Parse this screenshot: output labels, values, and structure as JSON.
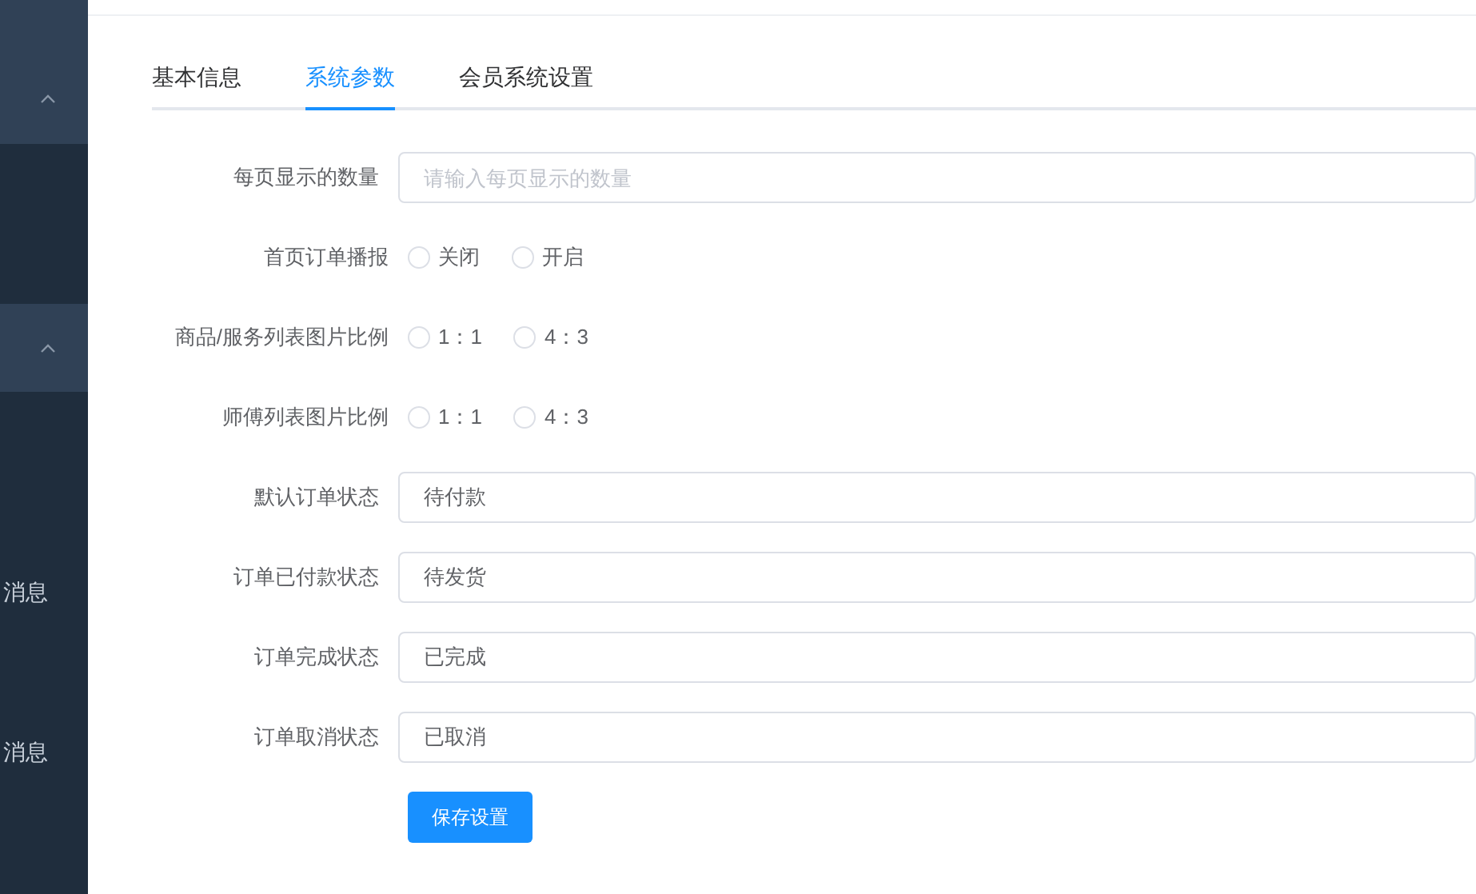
{
  "sidebar": {
    "groups": [
      {
        "expanded": true
      },
      {
        "expanded": true,
        "items": [
          {
            "label": "消息"
          },
          {
            "label": "消息"
          }
        ]
      }
    ]
  },
  "tabs": [
    {
      "label": "基本信息",
      "selected": false
    },
    {
      "label": "系统参数",
      "selected": true
    },
    {
      "label": "会员系统设置",
      "selected": false
    }
  ],
  "form": [
    {
      "kind": "input",
      "label": "每页显示的数量",
      "placeholder": "请输入每页显示的数量"
    },
    {
      "kind": "radio",
      "label": "首页订单播报",
      "options": [
        {
          "label": "关闭",
          "selected": false
        },
        {
          "label": "开启",
          "selected": false
        }
      ]
    },
    {
      "kind": "radio",
      "label": "商品/服务列表图片比例",
      "options": [
        {
          "label": "1：1",
          "selected": false
        },
        {
          "label": "4：3",
          "selected": false
        }
      ]
    },
    {
      "kind": "radio",
      "label": "师傅列表图片比例",
      "options": [
        {
          "label": "1：1",
          "selected": false
        },
        {
          "label": "4：3",
          "selected": false
        }
      ]
    },
    {
      "kind": "input",
      "label": "默认订单状态",
      "value": "待付款"
    },
    {
      "kind": "input",
      "label": "订单已付款状态",
      "value": "待发货"
    },
    {
      "kind": "input",
      "label": "订单完成状态",
      "value": "已完成"
    },
    {
      "kind": "input",
      "label": "订单取消状态",
      "value": "已取消"
    }
  ],
  "save_button": "保存设置"
}
